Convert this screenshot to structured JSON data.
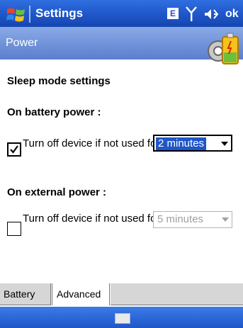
{
  "titlebar": {
    "title": "Settings",
    "e_label": "E",
    "ok_label": "ok",
    "icons": [
      "windows-start-icon",
      "e-notification-icon",
      "antenna-icon",
      "volume-icon"
    ]
  },
  "header": {
    "title": "Power",
    "icon": "power-settings-icon"
  },
  "content": {
    "sleep_heading": "Sleep mode settings",
    "battery": {
      "heading": "On battery power :",
      "checkbox_label": "Turn off device if not used for",
      "checked": true,
      "selected": "2 minutes"
    },
    "external": {
      "heading": "On external power :",
      "checkbox_label": "Turn off device if not used for",
      "checked": false,
      "selected": "5 minutes"
    }
  },
  "tabs": [
    {
      "label": "Battery",
      "active": false
    },
    {
      "label": "Advanced",
      "active": true
    }
  ],
  "bottombar": {
    "icon": "keyboard-icon"
  },
  "colors": {
    "titlebar": "#1f56c8",
    "header": "#6d8fd8",
    "selection": "#1f56c8"
  }
}
